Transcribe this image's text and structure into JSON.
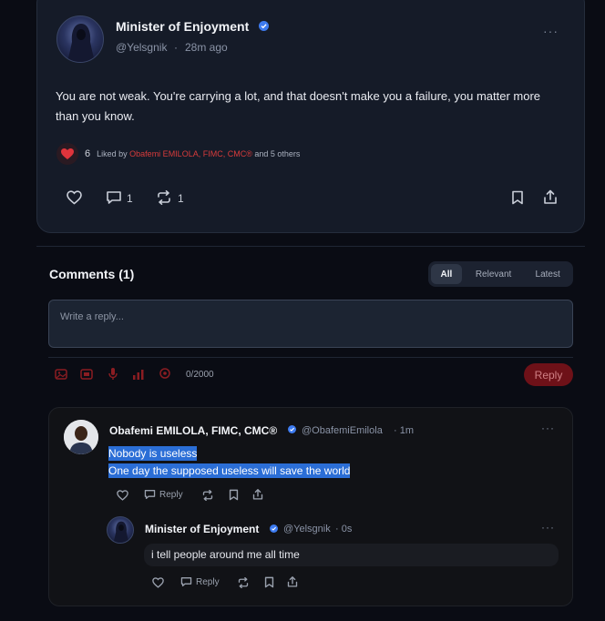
{
  "post": {
    "author_name": "Minister of Enjoyment",
    "author_handle": "@Yelsgnik",
    "time": "28m ago",
    "separator": "·",
    "more": "···",
    "text": "You are not weak. You're carrying a lot, and that doesn't make you a failure, you matter more than you know.",
    "like_count": "6",
    "liked_by_prefix": "Liked by",
    "liked_by_name": "Obafemi EMILOLA, FIMC, CMC®",
    "liked_by_suffix": "and 5 others",
    "comment_count": "1",
    "repost_count": "1"
  },
  "comments_section": {
    "title": "Comments (1)",
    "tabs": [
      {
        "label": "All",
        "active": true
      },
      {
        "label": "Relevant",
        "active": false
      },
      {
        "label": "Latest",
        "active": false
      }
    ],
    "input_placeholder": "Write a reply...",
    "char_count": "0/2000",
    "reply_button": "Reply"
  },
  "comment": {
    "author_name": "Obafemi EMILOLA, FIMC, CMC®",
    "author_handle": "@ObafemiEmilola",
    "time": "· 1m",
    "more": "···",
    "line1": "Nobody is useless",
    "line2": "One day the supposed useless will save the world",
    "reply_label": "Reply"
  },
  "nested_reply": {
    "author_name": "Minister of Enjoyment",
    "author_handle": "@Yelsgnik",
    "time": "· 0s",
    "more": "···",
    "text": "i tell people around me all time",
    "reply_label": "Reply"
  },
  "colors": {
    "accent_red": "#d83b3b",
    "verified_blue": "#3d7bf0",
    "selection_blue": "#2b6ed6",
    "card_bg": "#151b28"
  },
  "icons": [
    "heart-icon",
    "comment-icon",
    "repost-icon",
    "bookmark-icon",
    "share-icon",
    "image-icon",
    "gif-icon",
    "mic-icon",
    "poll-icon",
    "location-icon",
    "verified-icon"
  ]
}
